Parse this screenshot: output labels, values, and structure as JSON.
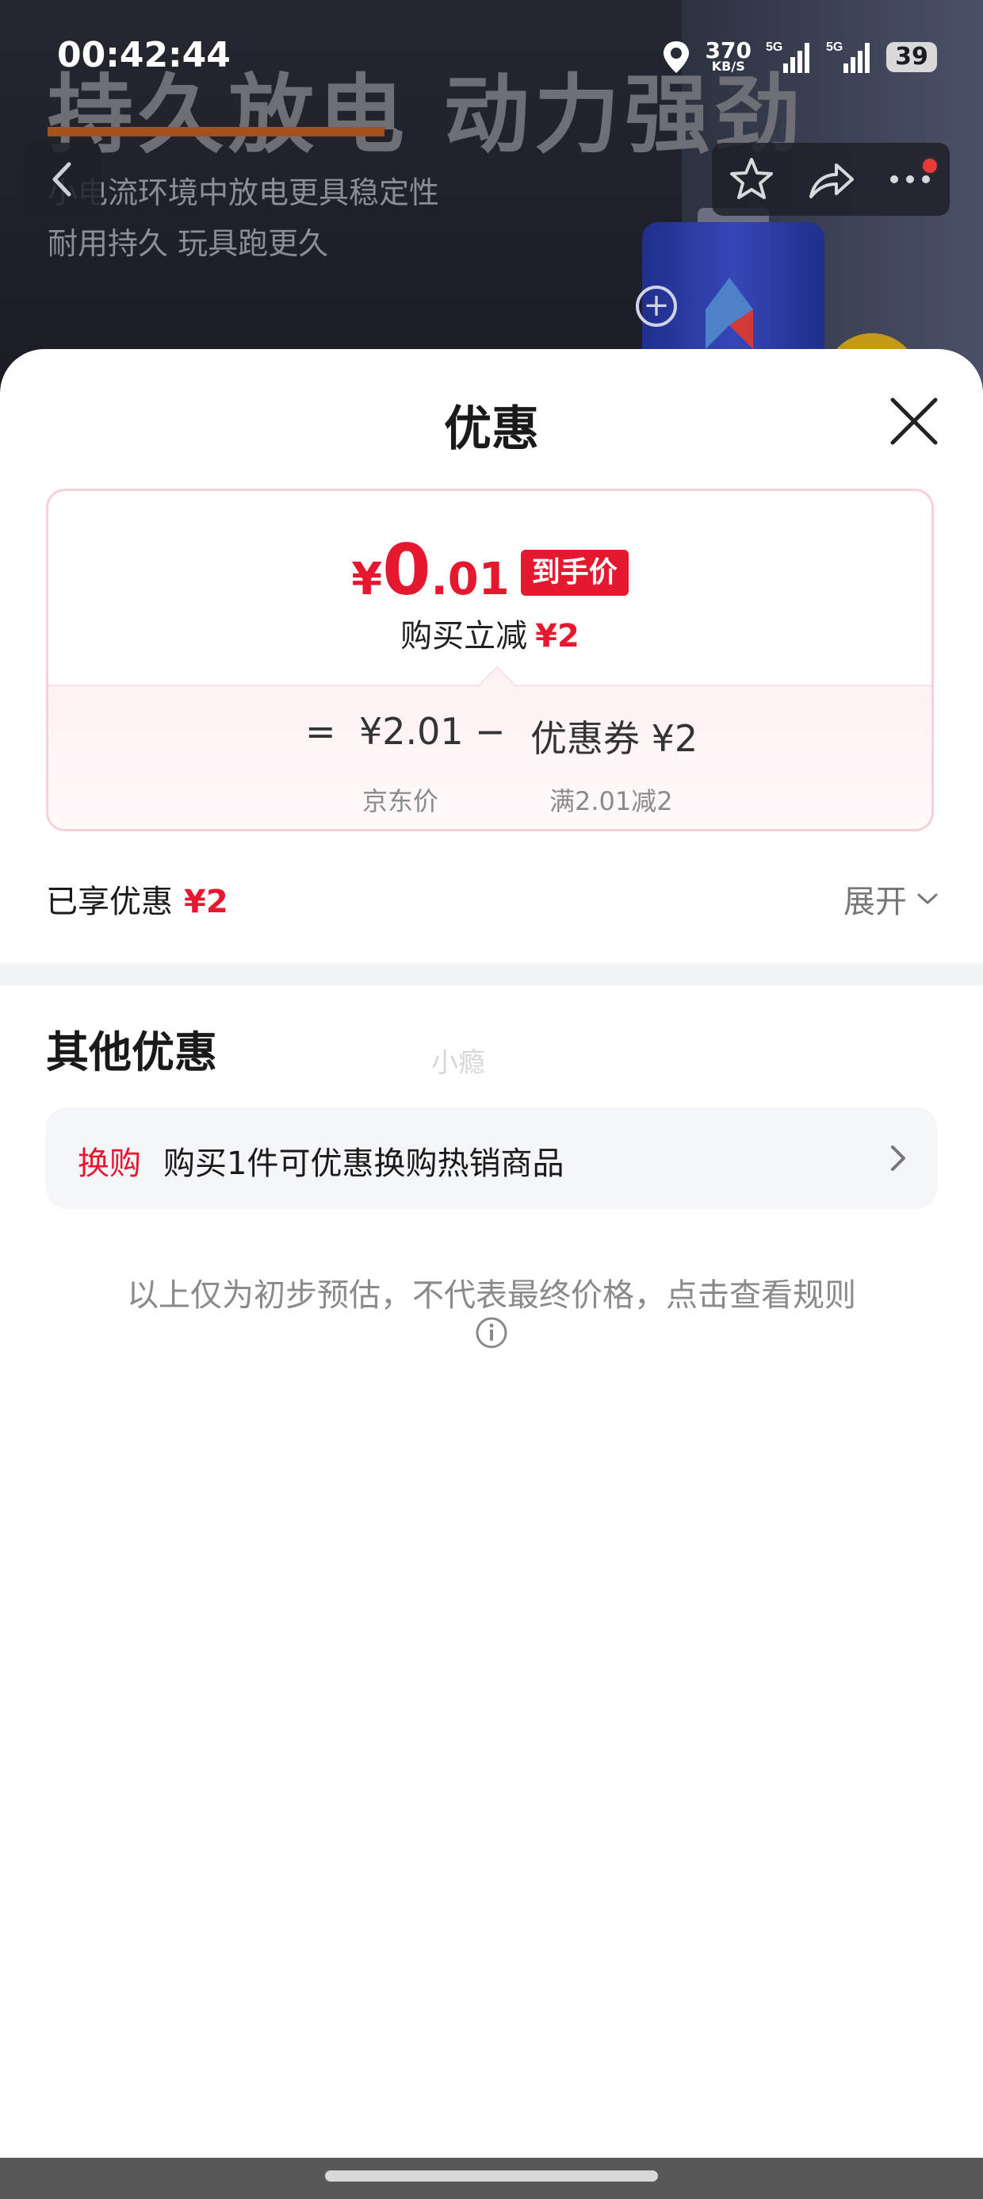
{
  "status_bar": {
    "time": "00:42:44",
    "speed": "370",
    "speed_unit": "KB/S",
    "network_1": "5G",
    "network_2": "5G",
    "battery": "39",
    "icons": [
      "location-icon",
      "signal-icon",
      "battery-icon"
    ]
  },
  "background": {
    "headline": "持久放电 动力强劲",
    "line1": "小电流环境中放电更具稳定性",
    "line2": "耐用持久 玩具跑更久"
  },
  "nav": {
    "icons": [
      "back-icon",
      "star-icon",
      "share-icon",
      "more-icon"
    ]
  },
  "sheet": {
    "title": "优惠",
    "close_icon": "close-icon"
  },
  "price_card": {
    "currency": "¥",
    "price_int": "0",
    "price_dec": ".01",
    "tag": "到手价",
    "save_label": "购买立减",
    "save_amount": "¥2",
    "equals": "=",
    "base_price": "¥2.01",
    "minus": "−",
    "coupon": "优惠券 ¥2",
    "base_label": "京东价",
    "coupon_label": "满2.01减2"
  },
  "enjoyed": {
    "label": "已享优惠",
    "amount": "¥2",
    "expand_label": "展开"
  },
  "other": {
    "title": "其他优惠",
    "watermark": "小瘾",
    "promo_tag": "换购",
    "promo_text": "购买1件可优惠换购热销商品"
  },
  "disclaimer": "以上仅为初步预估，不代表最终价格，点击查看规则",
  "colors": {
    "accent": "#e5182f",
    "card_border": "#f7d0d8",
    "divider": "#f3f4f7"
  }
}
